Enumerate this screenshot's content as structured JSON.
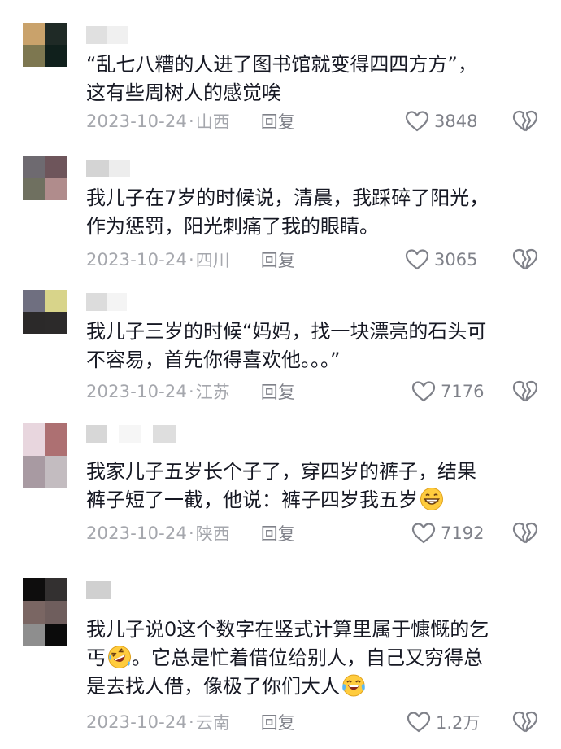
{
  "comments": [
    {
      "text": "“乱七八糟的人进了图书馆就变得四四方方”，\n这有些周树人的感觉唉",
      "date": "2023-10-24",
      "location": "山西",
      "reply_label": "回复",
      "likes": "3848",
      "avatar_colors": [
        "#c9a26b",
        "#1f2a26",
        "#7d7750",
        "#10201c"
      ],
      "name_colors": [
        "#e0e0e0",
        "#f0f0f0"
      ]
    },
    {
      "text": "我儿子在7岁的时候说，清晨，我踩碎了阳光，\n作为惩罚，阳光刺痛了我的眼睛。",
      "date": "2023-10-24",
      "location": "四川",
      "reply_label": "回复",
      "likes": "3065",
      "avatar_colors": [
        "#6e6a70",
        "#6e555b",
        "#6f7060",
        "#b08c8c"
      ],
      "name_colors": [
        "#d4d4d4",
        "#ededed"
      ]
    },
    {
      "text": "我儿子三岁的时候“妈妈，找一块漂亮的石头可\n不容易，首先你得喜欢他。。。”",
      "date": "2023-10-24",
      "location": "江苏",
      "reply_label": "回复",
      "likes": "7176",
      "avatar_colors": [
        "#6f6f80",
        "#d8d48a",
        "#2b2929",
        "#2c2a2a"
      ],
      "name_colors": [
        "#dcdcdc",
        "#f4f4f4"
      ]
    },
    {
      "text": "我家儿子五岁长个子了，穿四岁的裤子，结果\n裤子短了一截，他说：裤子四岁我五岁",
      "date": "2023-10-24",
      "location": "陕西",
      "reply_label": "回复",
      "likes": "7192",
      "avatar_colors": [
        "#e8d6de",
        "#ad7072",
        "#a89aa2",
        "#c3bcc0"
      ],
      "name_colors": [
        "#d7d7d7",
        "#f6f6f6",
        "#dedede"
      ]
    },
    {
      "text_parts": [
        "我儿子说0这个数字在竖式计算里属于慷慨的乞\n丐",
        "。它总是忙着借位给别人，自己又穷得总\n是去找人借，像极了你们大人"
      ],
      "date": "2023-10-24",
      "location": "云南",
      "reply_label": "回复",
      "likes": "1.2万",
      "avatar_colors": [
        "#0e0d0d",
        "#333030",
        "#7a6663",
        "#6f5e5d",
        "#8e8e8e",
        "#0b0b0b"
      ],
      "name_colors": [
        "#d0d0d0"
      ]
    }
  ],
  "icons": {
    "like": "heart-outline-icon",
    "dislike": "broken-heart-icon",
    "emoji_grin": "grinning-face-emoji",
    "emoji_rofl": "rolling-laughing-emoji",
    "emoji_joy": "tears-of-joy-emoji"
  },
  "colors": {
    "text": "#161823",
    "meta": "#a5a7ad",
    "action": "#7f8189"
  }
}
